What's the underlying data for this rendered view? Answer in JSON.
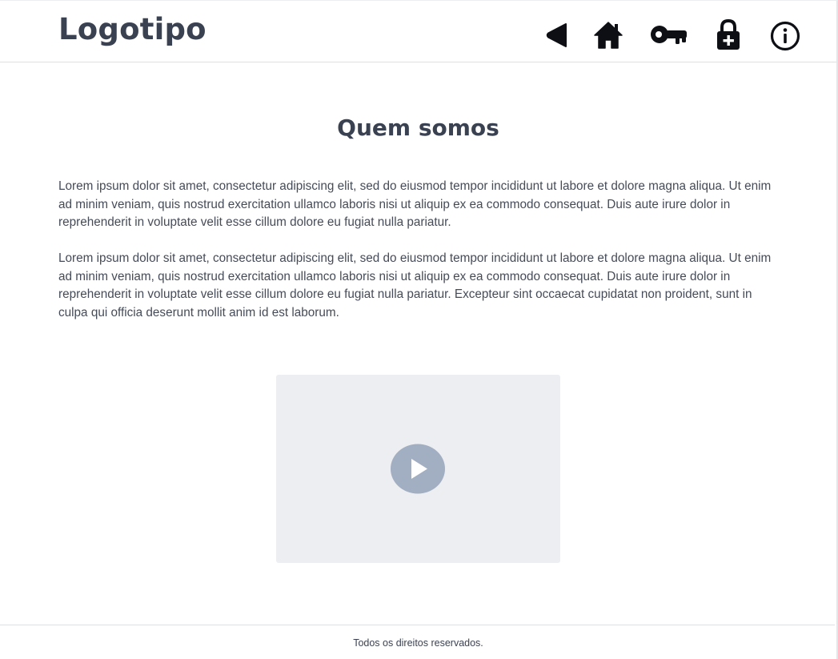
{
  "header": {
    "logo": "Logotipo",
    "nav": [
      {
        "icon": "back-arrow-icon"
      },
      {
        "icon": "home-icon"
      },
      {
        "icon": "key-icon"
      },
      {
        "icon": "lock-plus-icon"
      },
      {
        "icon": "info-icon"
      }
    ]
  },
  "main": {
    "title": "Quem somos",
    "paragraphs": [
      "Lorem ipsum dolor sit amet, consectetur adipiscing elit, sed do eiusmod tempor incididunt ut labore et dolore magna aliqua. Ut enim ad minim veniam, quis nostrud exercitation ullamco laboris nisi ut aliquip ex ea commodo consequat. Duis aute irure dolor in reprehenderit in voluptate velit esse cillum dolore eu fugiat nulla pariatur.",
      "Lorem ipsum dolor sit amet, consectetur adipiscing elit, sed do eiusmod tempor incididunt ut labore et dolore magna aliqua. Ut enim ad minim veniam, quis nostrud exercitation ullamco laboris nisi ut aliquip ex ea commodo consequat. Duis aute irure dolor in reprehenderit in voluptate velit esse cillum dolore eu fugiat nulla pariatur. Excepteur sint occaecat cupidatat non proident, sunt in culpa qui officia deserunt mollit anim id est laborum."
    ],
    "video": {
      "icon": "play-icon"
    }
  },
  "footer": {
    "text": "Todos os direitos reservados."
  },
  "colors": {
    "text": "#3a4151",
    "icon": "#0d0f14",
    "video_bg": "#eceef2",
    "play_button": "#a2aec1",
    "divider": "#dcdfe3"
  }
}
